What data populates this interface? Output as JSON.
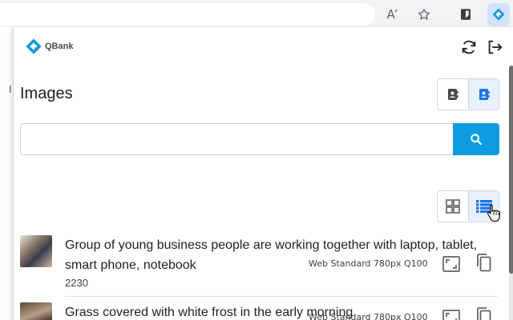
{
  "browser": {
    "read_aloud_label": "A’",
    "icons": [
      "read-aloud-icon",
      "star-icon",
      "bitwarden-icon",
      "qbank-extension-icon"
    ],
    "active_extension_bg": "#d3e3fd"
  },
  "background_page": {
    "visible_letter": "I"
  },
  "popup": {
    "logo_text": "QBank",
    "accent_color": "#0e9be0",
    "title": "Images",
    "search": {
      "value": "",
      "placeholder": ""
    },
    "mode_toggle": {
      "selected": "second"
    },
    "view_toggle": {
      "options": [
        "grid-view",
        "list-view"
      ],
      "selected": "list-view"
    },
    "items": [
      {
        "title": "Group of young business people are working together with laptop, tablet, smart phone, notebook",
        "meta": "Web Standard 780px Q100",
        "id": "2230"
      },
      {
        "title": "Grass covered with white frost in the early morning",
        "meta": "Web Standard 780px Q100",
        "id": ""
      }
    ]
  }
}
